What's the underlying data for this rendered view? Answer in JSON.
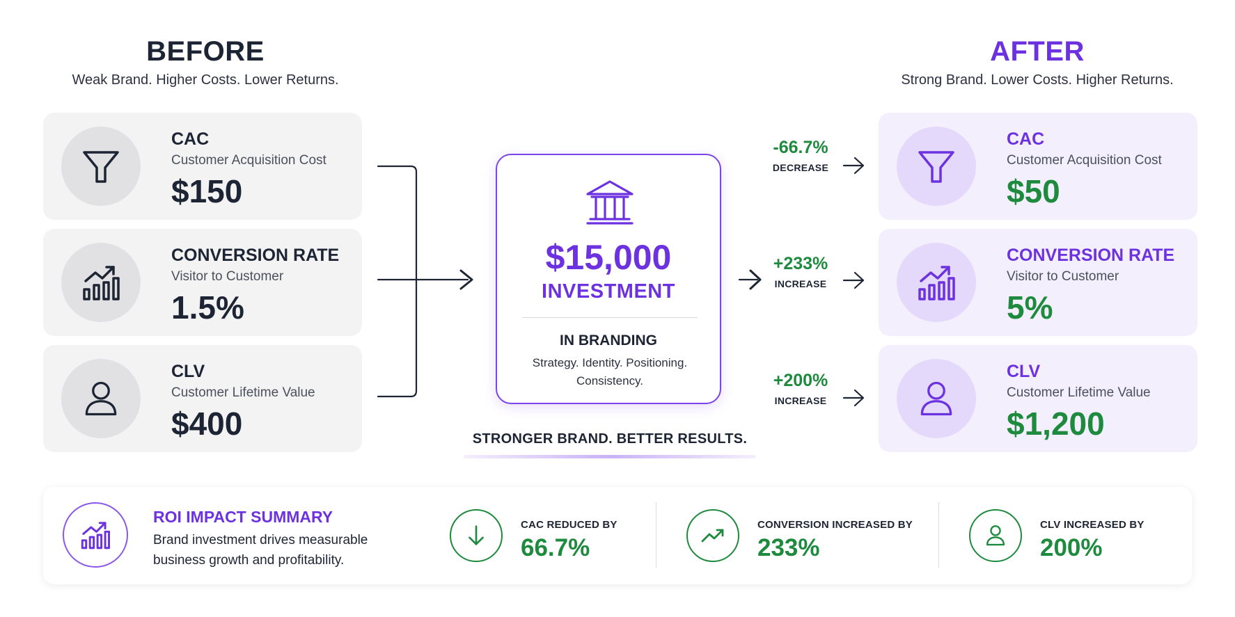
{
  "before": {
    "title": "BEFORE",
    "subtitle": "Weak Brand. Higher Costs. Lower Returns.",
    "cards": [
      {
        "title": "CAC",
        "subtitle": "Customer Acquisition Cost",
        "value": "$150",
        "icon": "funnel-icon"
      },
      {
        "title": "CONVERSION RATE",
        "subtitle": "Visitor to Customer",
        "value": "1.5%",
        "icon": "bar-chart-trend-icon"
      },
      {
        "title": "CLV",
        "subtitle": "Customer Lifetime Value",
        "value": "$400",
        "icon": "user-icon"
      }
    ]
  },
  "after": {
    "title": "AFTER",
    "subtitle": "Strong Brand. Lower Costs. Higher Returns.",
    "cards": [
      {
        "title": "CAC",
        "subtitle": "Customer Acquisition Cost",
        "value": "$50",
        "icon": "funnel-icon"
      },
      {
        "title": "CONVERSION RATE",
        "subtitle": "Visitor to Customer",
        "value": "5%",
        "icon": "bar-chart-trend-icon"
      },
      {
        "title": "CLV",
        "subtitle": "Customer Lifetime Value",
        "value": "$1,200",
        "icon": "user-icon"
      }
    ]
  },
  "deltas": [
    {
      "value": "-66.7%",
      "label": "DECREASE"
    },
    {
      "value": "+233%",
      "label": "INCREASE"
    },
    {
      "value": "+200%",
      "label": "INCREASE"
    }
  ],
  "investment": {
    "icon": "bank-icon",
    "amount": "$15,000",
    "label": "INVESTMENT",
    "in_label": "IN BRANDING",
    "description": "Strategy. Identity. Positioning. Consistency.",
    "tagline": "STRONGER BRAND. BETTER RESULTS."
  },
  "summary": {
    "icon": "bar-chart-trend-icon",
    "title": "ROI IMPACT SUMMARY",
    "description": "Brand investment drives measurable business growth and profitability.",
    "kpis": [
      {
        "label": "CAC REDUCED BY",
        "value": "66.7%",
        "icon": "arrow-down-icon"
      },
      {
        "label": "CONVERSION INCREASED BY",
        "value": "233%",
        "icon": "trend-up-icon"
      },
      {
        "label": "CLV INCREASED BY",
        "value": "200%",
        "icon": "user-icon"
      }
    ]
  },
  "colors": {
    "accent_purple": "#6d32e0",
    "positive_green": "#1e8a3e",
    "text_dark": "#1d2433",
    "before_card_bg": "#f3f3f4",
    "after_card_bg": "#f3effd"
  }
}
